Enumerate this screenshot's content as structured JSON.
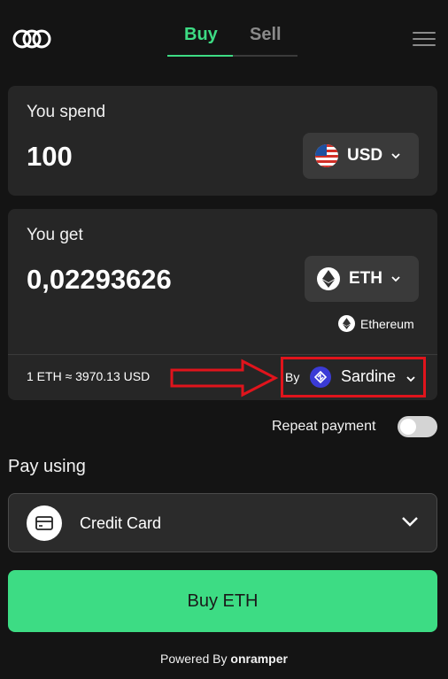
{
  "header": {
    "tabs": [
      {
        "label": "Buy",
        "active": true
      },
      {
        "label": "Sell",
        "active": false
      }
    ],
    "logo_icon": "onramper-logo-icon",
    "menu_icon": "hamburger-menu-icon"
  },
  "spend": {
    "label": "You spend",
    "amount": "100",
    "currency": "USD",
    "currency_icon": "us-flag-icon"
  },
  "get": {
    "label": "You get",
    "amount": "0,02293626",
    "currency": "ETH",
    "currency_icon": "ethereum-icon",
    "network": "Ethereum",
    "rate": "1 ETH ≈ 3970.13 USD",
    "by_label": "By",
    "provider": "Sardine",
    "provider_icon": "sardine-icon"
  },
  "repeat_payment": {
    "label": "Repeat payment",
    "enabled": false
  },
  "pay": {
    "heading": "Pay using",
    "method": "Credit Card",
    "method_icon": "credit-card-icon"
  },
  "buy_button": "Buy ETH",
  "footer": {
    "powered_by": "Powered By",
    "brand": "onramper"
  },
  "colors": {
    "background": "#141414",
    "card": "#262626",
    "accent": "#3ddc84",
    "highlight": "#e0141c",
    "provider": "#3b3bd6"
  }
}
